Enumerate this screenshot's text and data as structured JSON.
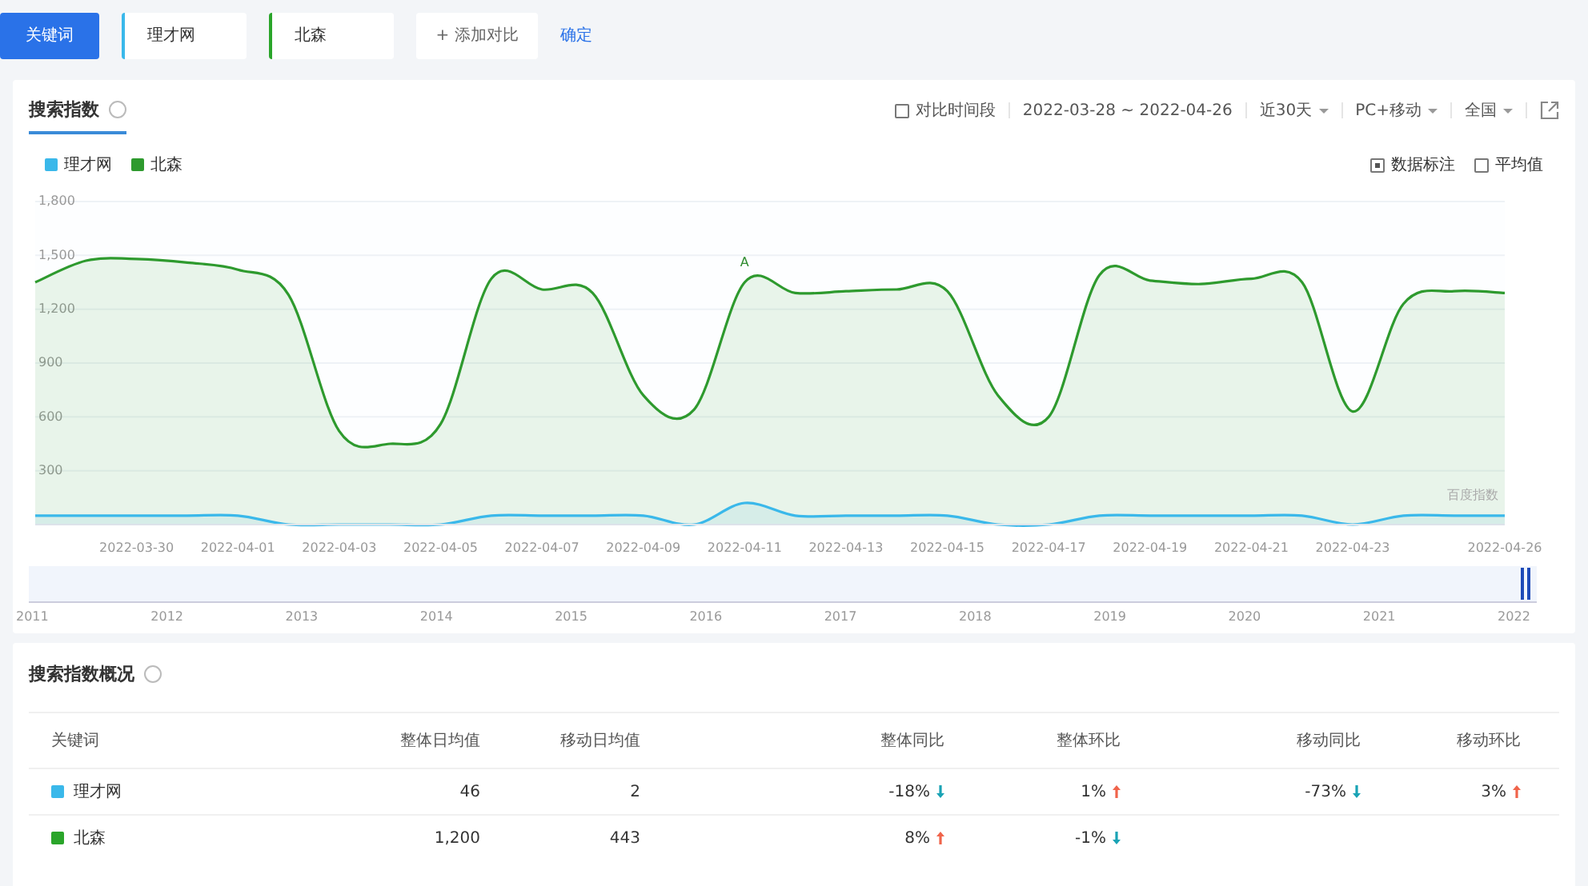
{
  "toolbar": {
    "keyword_button": "关键词",
    "keywords": [
      {
        "text": "理才网",
        "color": "#3ab8ea"
      },
      {
        "text": "北森",
        "color": "#2aa52a"
      }
    ],
    "add_button": "+ 添加对比",
    "confirm_link": "确定"
  },
  "trend_panel": {
    "title": "搜索指数",
    "compare_period": {
      "label": "对比时间段",
      "checked": false
    },
    "date_range": "2022-03-28 ~ 2022-04-26",
    "period": "近30天",
    "device": "PC+移动",
    "region": "全国",
    "options": [
      {
        "label": "数据标注",
        "checked": true
      },
      {
        "label": "平均值",
        "checked": false
      }
    ],
    "chart_data": {
      "type": "area",
      "grid": true,
      "ylim": [
        0,
        1800
      ],
      "yticks": [
        {
          "value": 300,
          "label": "300"
        },
        {
          "value": 600,
          "label": "600"
        },
        {
          "value": 900,
          "label": "900"
        },
        {
          "value": 1200,
          "label": "1,200"
        },
        {
          "value": 1500,
          "label": "1,500"
        },
        {
          "value": 1800,
          "label": "1,800"
        }
      ],
      "categories": [
        null,
        null,
        "2022-03-30",
        null,
        "2022-04-01",
        null,
        "2022-04-03",
        null,
        "2022-04-05",
        null,
        "2022-04-07",
        null,
        "2022-04-09",
        null,
        "2022-04-11",
        null,
        "2022-04-13",
        null,
        "2022-04-15",
        null,
        "2022-04-17",
        null,
        "2022-04-19",
        null,
        "2022-04-21",
        null,
        "2022-04-23",
        null,
        null,
        "2022-04-26"
      ],
      "series": [
        {
          "name": "理才网",
          "color": "#3ab8ea",
          "values": [
            50,
            50,
            50,
            50,
            50,
            0,
            0,
            0,
            0,
            50,
            50,
            50,
            50,
            0,
            120,
            50,
            50,
            50,
            50,
            0,
            0,
            50,
            50,
            50,
            50,
            50,
            0,
            50,
            50,
            50
          ]
        },
        {
          "name": "北森",
          "color": "#2e9a2e",
          "values": [
            1350,
            1470,
            1480,
            1460,
            1420,
            1280,
            520,
            450,
            560,
            1370,
            1310,
            1290,
            720,
            640,
            1350,
            1290,
            1300,
            1310,
            1300,
            720,
            600,
            1390,
            1360,
            1340,
            1370,
            1350,
            630,
            1230,
            1300,
            1290
          ]
        }
      ],
      "annotations": [
        "A",
        "百度指数"
      ]
    },
    "timeline_years": [
      "2011",
      "2012",
      "2013",
      "2014",
      "2015",
      "2016",
      "2017",
      "2018",
      "2019",
      "2020",
      "2021",
      "2022"
    ]
  },
  "overview": {
    "title": "搜索指数概况",
    "columns": [
      "关键词",
      "整体日均值",
      "移动日均值",
      "整体同比",
      "整体环比",
      "移动同比",
      "移动环比"
    ],
    "rows": [
      {
        "keyword": "理才网",
        "color": "#3ab8ea",
        "values": [
          "46",
          "2"
        ],
        "changes": [
          {
            "text": "-18%",
            "rising": false
          },
          {
            "text": "1%",
            "rising": true
          },
          {
            "text": "-73%",
            "rising": false
          },
          {
            "text": "3%",
            "rising": true
          }
        ]
      },
      {
        "keyword": "北森",
        "color": "#2aa52a",
        "values": [
          "1,200",
          "443"
        ],
        "changes": [
          {
            "text": "8%",
            "rising": true
          },
          {
            "text": "-1%",
            "rising": false
          }
        ]
      }
    ]
  }
}
